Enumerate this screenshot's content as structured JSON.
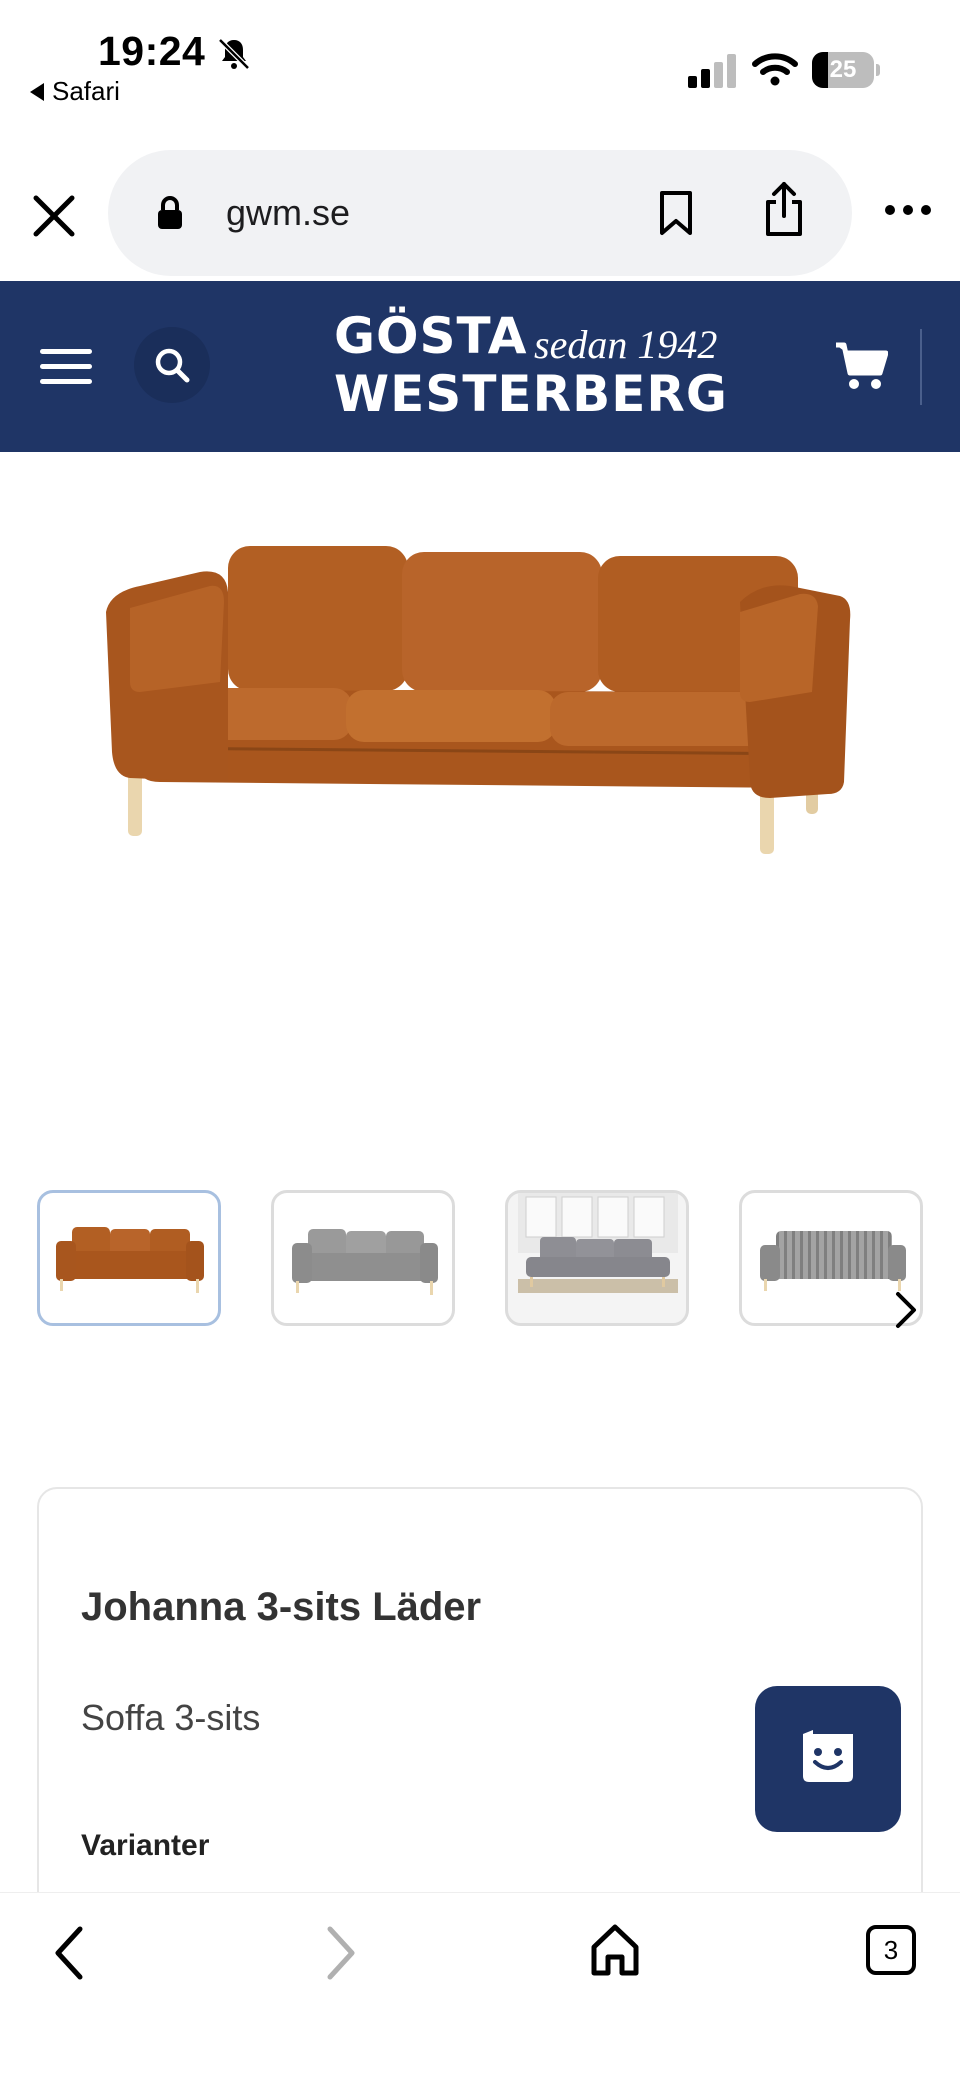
{
  "status_bar": {
    "time": "19:24",
    "back_app": "Safari",
    "battery_level": "25",
    "battery_fraction": 0.25,
    "icons": [
      "bell-slash-icon",
      "cellular-signal-icon",
      "wifi-icon",
      "battery-icon"
    ]
  },
  "browser": {
    "url": "gwm.se",
    "icons": [
      "close-icon",
      "lock-icon",
      "bookmark-icon",
      "share-icon",
      "more-icon"
    ]
  },
  "site_header": {
    "logo": {
      "line1": "GÖSTA",
      "tagline": "sedan 1942",
      "line2": "WESTERBERG"
    },
    "icons": [
      "menu-icon",
      "search-icon",
      "cart-icon"
    ],
    "background": "#1f3566"
  },
  "gallery": {
    "thumbnail_count": 4,
    "active_index": 0,
    "icons": [
      "chevron-right-icon"
    ]
  },
  "product": {
    "title": "Johanna 3-sits Läder",
    "subtitle": "Soffa 3-sits",
    "variants_label": "Varianter"
  },
  "chat": {
    "icon": "chat-smile-icon",
    "color": "#1f3566"
  },
  "toolbar": {
    "tab_count": "3",
    "icons": [
      "back-icon",
      "forward-icon",
      "home-icon",
      "tabs-icon"
    ]
  }
}
